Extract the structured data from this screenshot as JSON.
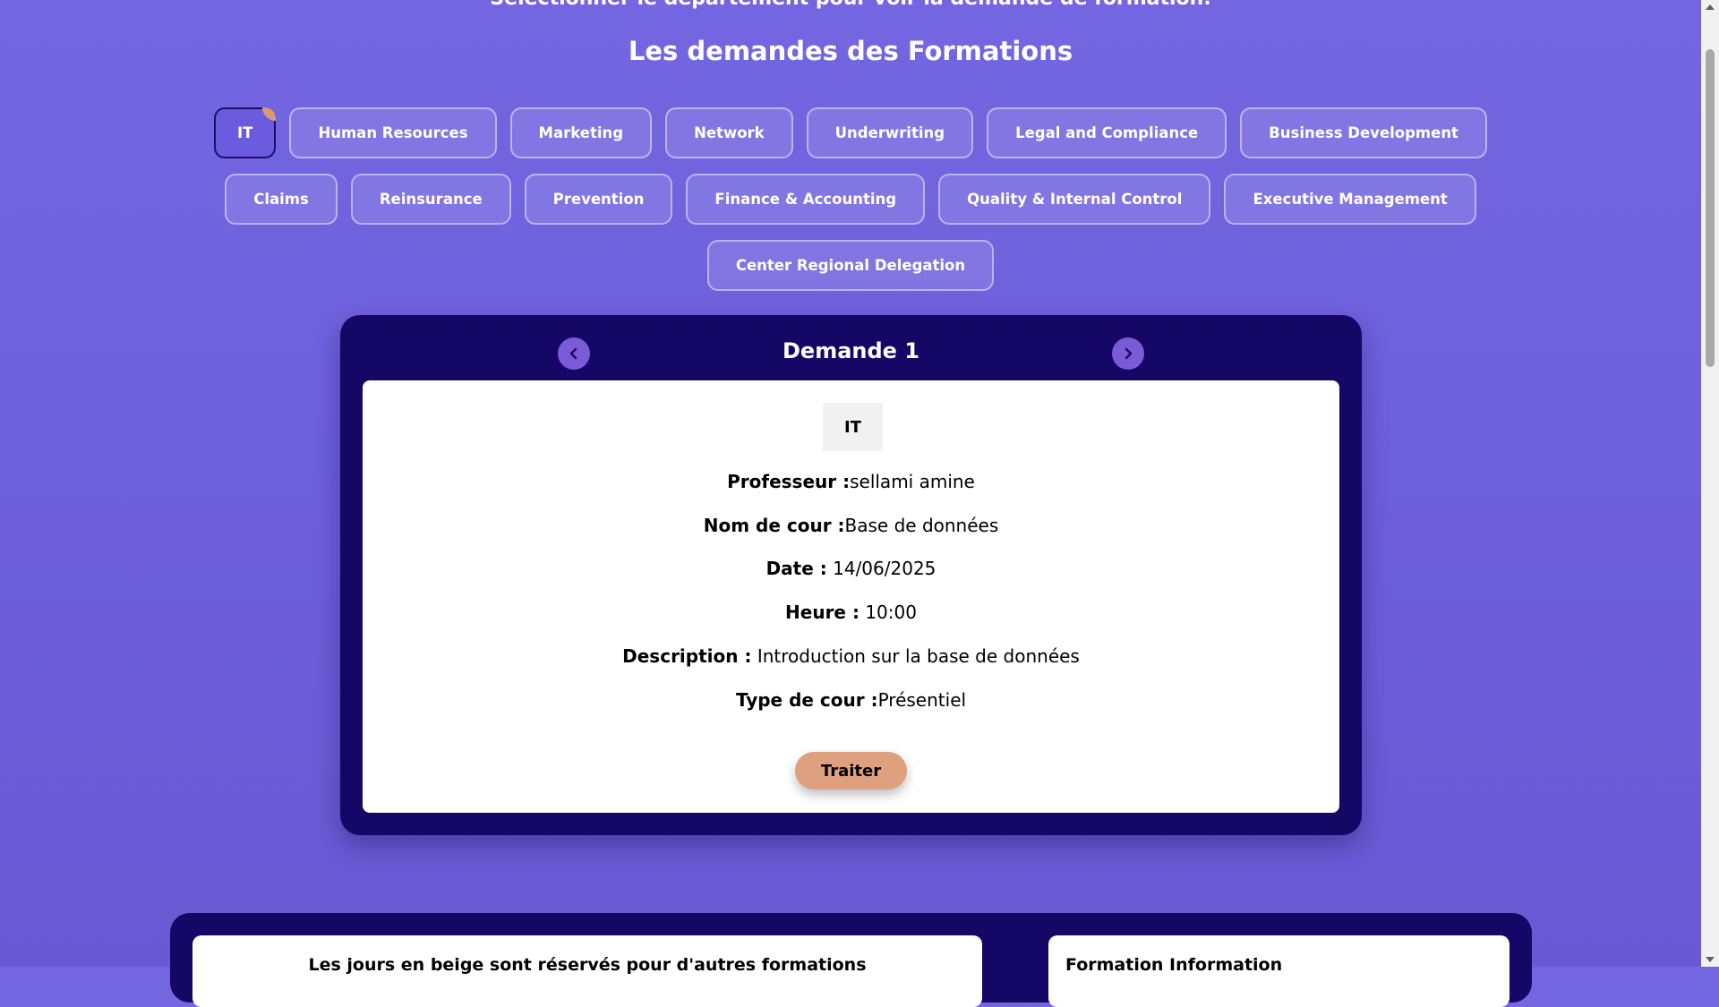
{
  "header": {
    "instruction": "Selectionner le département pour voir la demande de formation.",
    "title": "Les demandes des Formations"
  },
  "departments": {
    "row1": [
      "IT",
      "Human Resources",
      "Marketing",
      "Network",
      "Underwriting",
      "Legal and Compliance",
      "Business Development"
    ],
    "row2": [
      "Claims",
      "Reinsurance",
      "Prevention",
      "Finance & Accounting",
      "Quality & Internal Control",
      "Executive Management"
    ],
    "row3": [
      "Center Regional Delegation"
    ],
    "selected": "IT"
  },
  "request": {
    "title": "Demande 1",
    "department": "IT",
    "professor_label": "Professeur :",
    "professor_value": "sellami amine",
    "course_label": "Nom de cour :",
    "course_value": "Base de données",
    "date_label": "Date :",
    "date_value": " 14/06/2025",
    "time_label": "Heure :",
    "time_value": " 10:00",
    "description_label": "Description :",
    "description_value": " Introduction sur la base de données",
    "type_label": "Type de cour :",
    "type_value": "Présentiel",
    "action_label": "Traiter"
  },
  "calendar": {
    "note": "Les jours en beige sont réservés pour d'autres formations"
  },
  "formation_info": {
    "title": "Formation Information"
  },
  "colors": {
    "background": "#7466e0",
    "panel": "#150766",
    "accent": "#dfa07f",
    "nav_button": "#7b5ad8"
  },
  "icons": {
    "prev": "chevron-left-icon",
    "next": "chevron-right-icon"
  }
}
